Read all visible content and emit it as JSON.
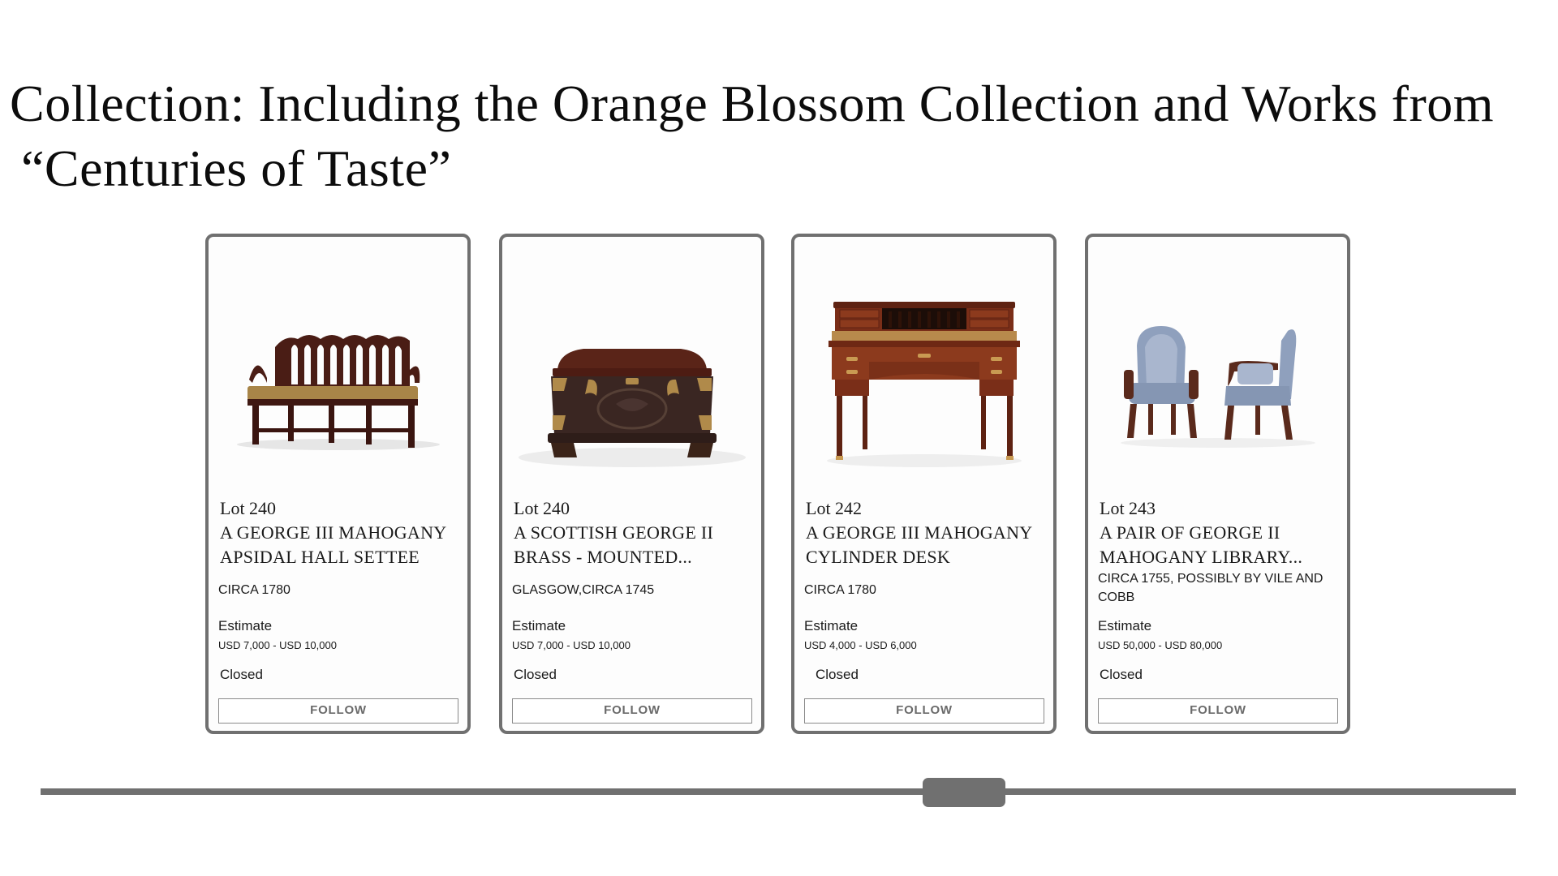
{
  "page": {
    "title_line1": "Collection: Including the Orange Blossom Collection and Works from",
    "title_line2": "“Centuries of Taste”"
  },
  "lots": [
    {
      "lot_label": "Lot 240",
      "title": "A GEORGE III MAHOGANY APSIDAL HALL SETTEE",
      "date": "CIRCA 1780",
      "estimate_label": "Estimate",
      "estimate": "USD 7,000 - USD 10,000",
      "status": "Closed",
      "follow_label": "FOLLOW",
      "image_icon": "settee-image"
    },
    {
      "lot_label": "Lot 240",
      "title": "A SCOTTISH GEORGE II BRASS - MOUNTED...",
      "date": "GLASGOW,CIRCA 1745",
      "estimate_label": "Estimate",
      "estimate": "USD 7,000 - USD 10,000",
      "status": "Closed",
      "follow_label": "FOLLOW",
      "image_icon": "brass-mounted-chest-image"
    },
    {
      "lot_label": "Lot 242",
      "title": "A GEORGE III MAHOGANY CYLINDER DESK",
      "date": "CIRCA 1780",
      "estimate_label": "Estimate",
      "estimate": "USD 4,000 - USD 6,000",
      "status": "Closed",
      "follow_label": "FOLLOW",
      "image_icon": "cylinder-desk-image"
    },
    {
      "lot_label": "Lot 243",
      "title": "A PAIR OF GEORGE II MAHOGANY LIBRARY...",
      "date": "CIRCA 1755, POSSIBLY BY VILE AND COBB",
      "estimate_label": "Estimate",
      "estimate": "USD 50,000 - USD 80,000",
      "status": "Closed",
      "follow_label": "FOLLOW",
      "image_icon": "library-armchairs-image"
    }
  ],
  "colors": {
    "card_border": "#707070",
    "scrollbar": "#707070",
    "button_text": "#6a6a6a",
    "mahogany": "#6b2a1c",
    "upholstery_blue": "#8fa0bd"
  }
}
